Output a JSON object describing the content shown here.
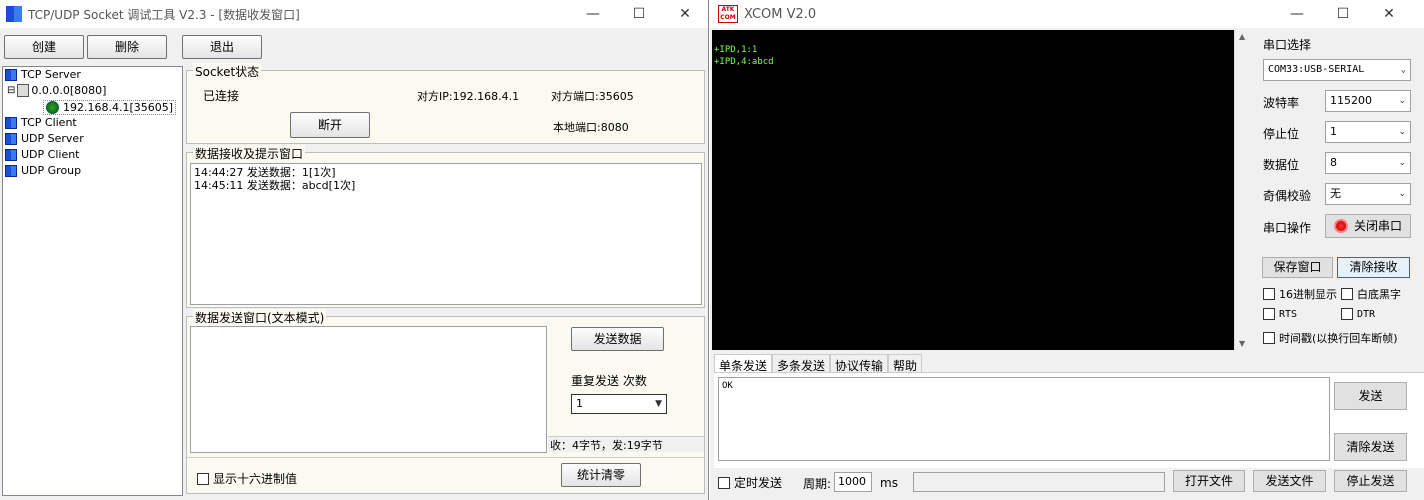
{
  "tcp_tool": {
    "title": "TCP/UDP Socket 调试工具 V2.3 - [数据收发窗口]",
    "toolbar": {
      "create": "创建",
      "delete": "删除",
      "exit": "退出"
    },
    "tree": [
      {
        "label": "TCP Server"
      },
      {
        "label": "0.0.0.0[8080]"
      },
      {
        "label": "192.168.4.1[35605]"
      },
      {
        "label": "TCP Client"
      },
      {
        "label": "UDP Server"
      },
      {
        "label": "UDP Client"
      },
      {
        "label": "UDP Group"
      }
    ],
    "socket": {
      "group_label": "Socket状态",
      "status": "已连接",
      "peer_ip": "对方IP:192.168.4.1",
      "peer_port": "对方端口:35605",
      "local_port": "本地端口:8080",
      "disconnect": "断开"
    },
    "receive": {
      "group_label": "数据接收及提示窗口",
      "lines": [
        "14:44:27 发送数据：1[1次]",
        "14:45:11 发送数据：abcd[1次]"
      ]
    },
    "send": {
      "group_label": "数据发送窗口(文本模式)",
      "send_button": "发送数据",
      "repeat_label": "重复发送 次数",
      "repeat_value": "1",
      "stats": "收：4字节，发:19字节",
      "hex_label": "显示十六进制值",
      "reset_button": "统计清零"
    }
  },
  "xcom": {
    "logo": "ATK COM",
    "title": "XCOM V2.0",
    "console_lines": [
      "+IPD,1:1",
      "+IPD,4:abcd"
    ],
    "port_select_label": "串口选择",
    "port_value": "COM33:USB-SERIAL",
    "baud_label": "波特率",
    "baud_value": "115200",
    "stop_label": "停止位",
    "stop_value": "1",
    "data_label": "数据位",
    "data_value": "8",
    "parity_label": "奇偶校验",
    "parity_value": "无",
    "op_label": "串口操作",
    "close_port": "关闭串口",
    "save_window": "保存窗口",
    "clear_receive": "清除接收",
    "hex_display": "16进制显示",
    "white_black": "白底黑字",
    "rts": "RTS",
    "dtr": "DTR",
    "timestamp": "时间戳(以换行回车断帧)",
    "tabs": [
      "单条发送",
      "多条发送",
      "协议传输",
      "帮助"
    ],
    "send_text": "OK",
    "send_btn": "发送",
    "clear_send": "清除发送",
    "timed_send": "定时发送",
    "period_label": "周期:",
    "period_value": "1000",
    "ms": "ms",
    "open_file": "打开文件",
    "send_file": "发送文件",
    "stop_send": "停止发送"
  }
}
